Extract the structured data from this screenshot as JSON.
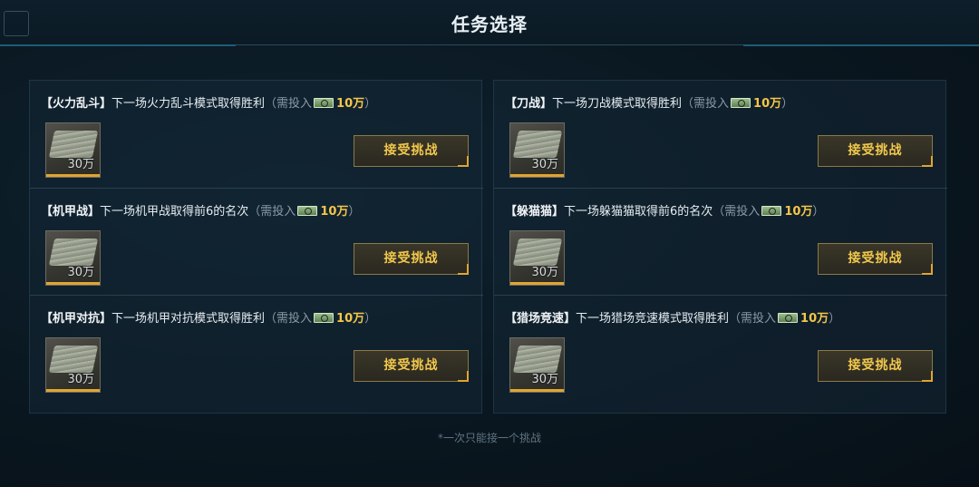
{
  "header": {
    "title": "任务选择"
  },
  "challenges": [
    {
      "tag": "【火力乱斗】",
      "text": "下一场火力乱斗模式取得胜利",
      "cost_prefix": "（需投入",
      "amount": "10万",
      "cost_suffix": "）",
      "reward_qty": "30万",
      "accept_label": "接受挑战",
      "reward_icon": "cash-stack-icon"
    },
    {
      "tag": "【机甲战】",
      "text": "下一场机甲战取得前6的名次",
      "cost_prefix": "（需投入",
      "amount": "10万",
      "cost_suffix": "）",
      "reward_qty": "30万",
      "accept_label": "接受挑战",
      "reward_icon": "cash-stack-icon"
    },
    {
      "tag": "【机甲对抗】",
      "text": "下一场机甲对抗模式取得胜利",
      "cost_prefix": "（需投入",
      "amount": "10万",
      "cost_suffix": "）",
      "reward_qty": "30万",
      "accept_label": "接受挑战",
      "reward_icon": "cash-stack-icon"
    },
    {
      "tag": "【刀战】",
      "text": "下一场刀战模式取得胜利",
      "cost_prefix": "（需投入",
      "amount": "10万",
      "cost_suffix": "）",
      "reward_qty": "30万",
      "accept_label": "接受挑战",
      "reward_icon": "cash-stack-icon"
    },
    {
      "tag": "【躲猫猫】",
      "text": "下一场躲猫猫取得前6的名次",
      "cost_prefix": "（需投入",
      "amount": "10万",
      "cost_suffix": "）",
      "reward_qty": "30万",
      "accept_label": "接受挑战",
      "reward_icon": "cash-stack-icon"
    },
    {
      "tag": "【猎场竞速】",
      "text": "下一场猎场竞速模式取得胜利",
      "cost_prefix": "（需投入",
      "amount": "10万",
      "cost_suffix": "）",
      "reward_qty": "30万",
      "accept_label": "接受挑战",
      "reward_icon": "cash-stack-icon"
    }
  ],
  "footer": {
    "note": "*一次只能接一个挑战"
  },
  "colors": {
    "accent_gold": "#f1c84c",
    "background": "#0a1720",
    "reward_bar": "#e0a531"
  }
}
